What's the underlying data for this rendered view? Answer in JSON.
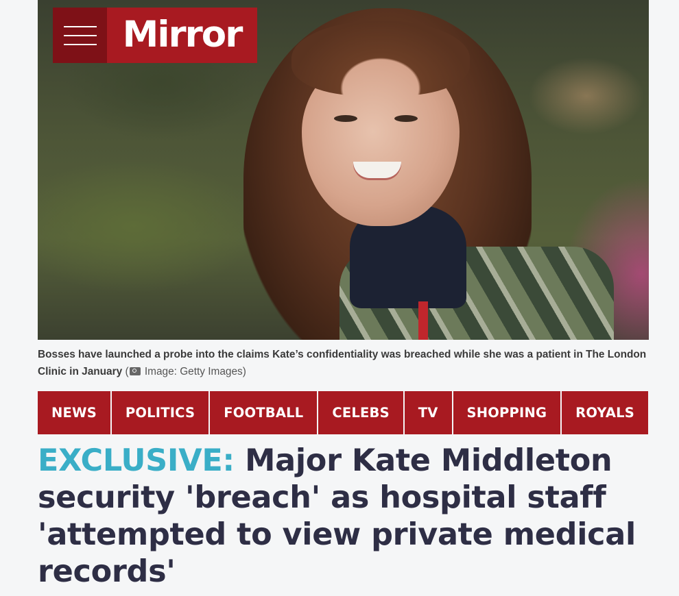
{
  "header": {
    "logo_text": "Mirror",
    "menu_label": "Menu",
    "brand_color": "#a81a21"
  },
  "hero": {
    "image_alt": "Kate Middleton smiling outdoors"
  },
  "caption": {
    "text": "Bosses have launched a probe into the claims Kate’s confidentiality was breached while she was a patient in The London Clinic in January",
    "credit_open": "(",
    "credit_icon": "camera-icon",
    "credit_text": " Image: Getty Images)"
  },
  "nav": {
    "items": [
      {
        "label": "NEWS"
      },
      {
        "label": "POLITICS"
      },
      {
        "label": "FOOTBALL"
      },
      {
        "label": "CELEBS"
      },
      {
        "label": "TV"
      },
      {
        "label": "SHOPPING"
      },
      {
        "label": "ROYALS"
      }
    ]
  },
  "article": {
    "kicker": "EXCLUSIVE:",
    "headline": "Major Kate Middleton security 'breach' as hospital staff 'attempted to view private medical records'",
    "kicker_color": "#3aaec7"
  }
}
